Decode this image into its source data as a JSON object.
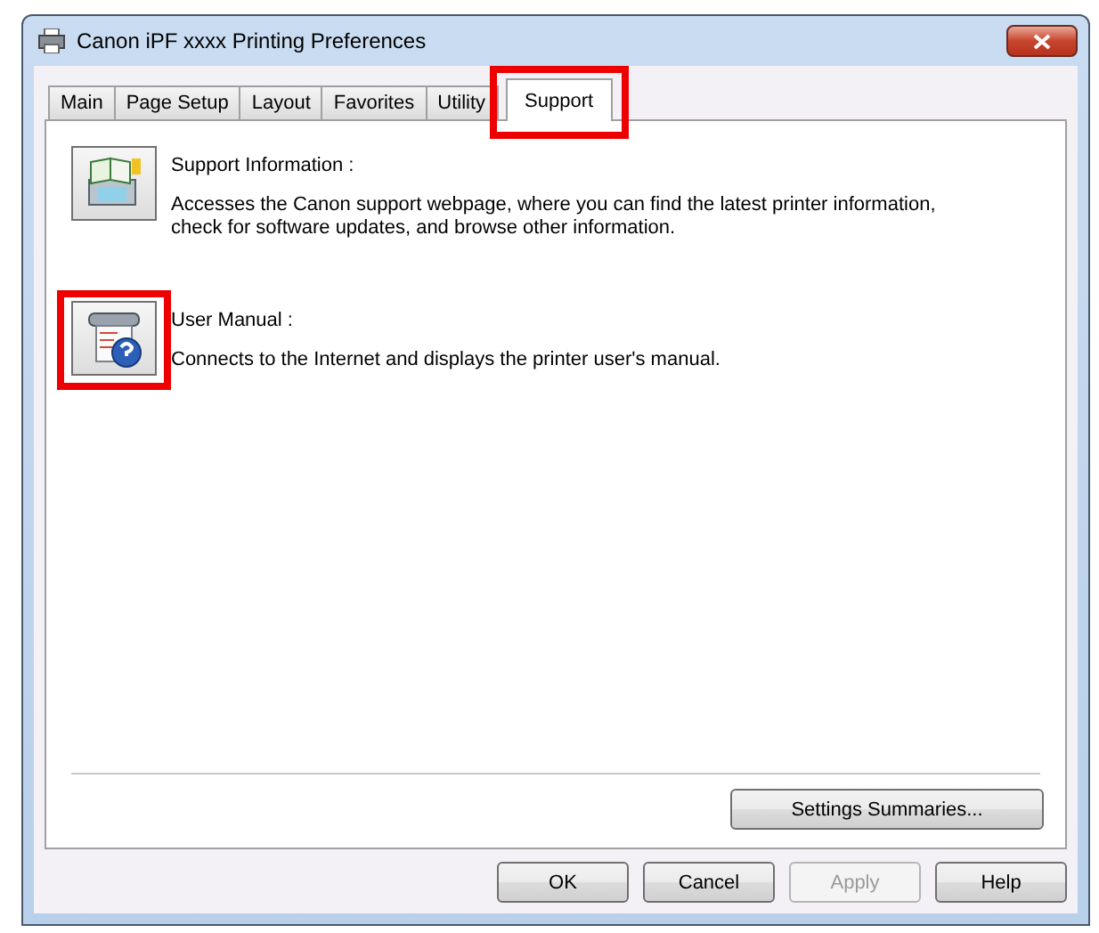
{
  "window": {
    "title": "Canon iPF xxxx  Printing Preferences"
  },
  "tabs": [
    {
      "label": "Main",
      "selected": false,
      "highlighted": false
    },
    {
      "label": "Page Setup",
      "selected": false,
      "highlighted": false
    },
    {
      "label": "Layout",
      "selected": false,
      "highlighted": false
    },
    {
      "label": "Favorites",
      "selected": false,
      "highlighted": false
    },
    {
      "label": "Utility",
      "selected": false,
      "highlighted": false
    },
    {
      "label": "Support",
      "selected": true,
      "highlighted": true
    }
  ],
  "items": [
    {
      "kind": "info",
      "title": "Support Information :",
      "description": "Accesses the Canon support webpage, where you can find the latest printer information, check for software updates, and browse other information.",
      "highlighted": false
    },
    {
      "kind": "manual",
      "title": "User Manual :",
      "description": "Connects to the Internet and displays the printer user's manual.",
      "highlighted": true
    }
  ],
  "summary_button": "Settings Summaries...",
  "buttons": [
    {
      "label": "OK",
      "disabled": false
    },
    {
      "label": "Cancel",
      "disabled": false
    },
    {
      "label": "Apply",
      "disabled": true
    },
    {
      "label": "Help",
      "disabled": false
    }
  ]
}
